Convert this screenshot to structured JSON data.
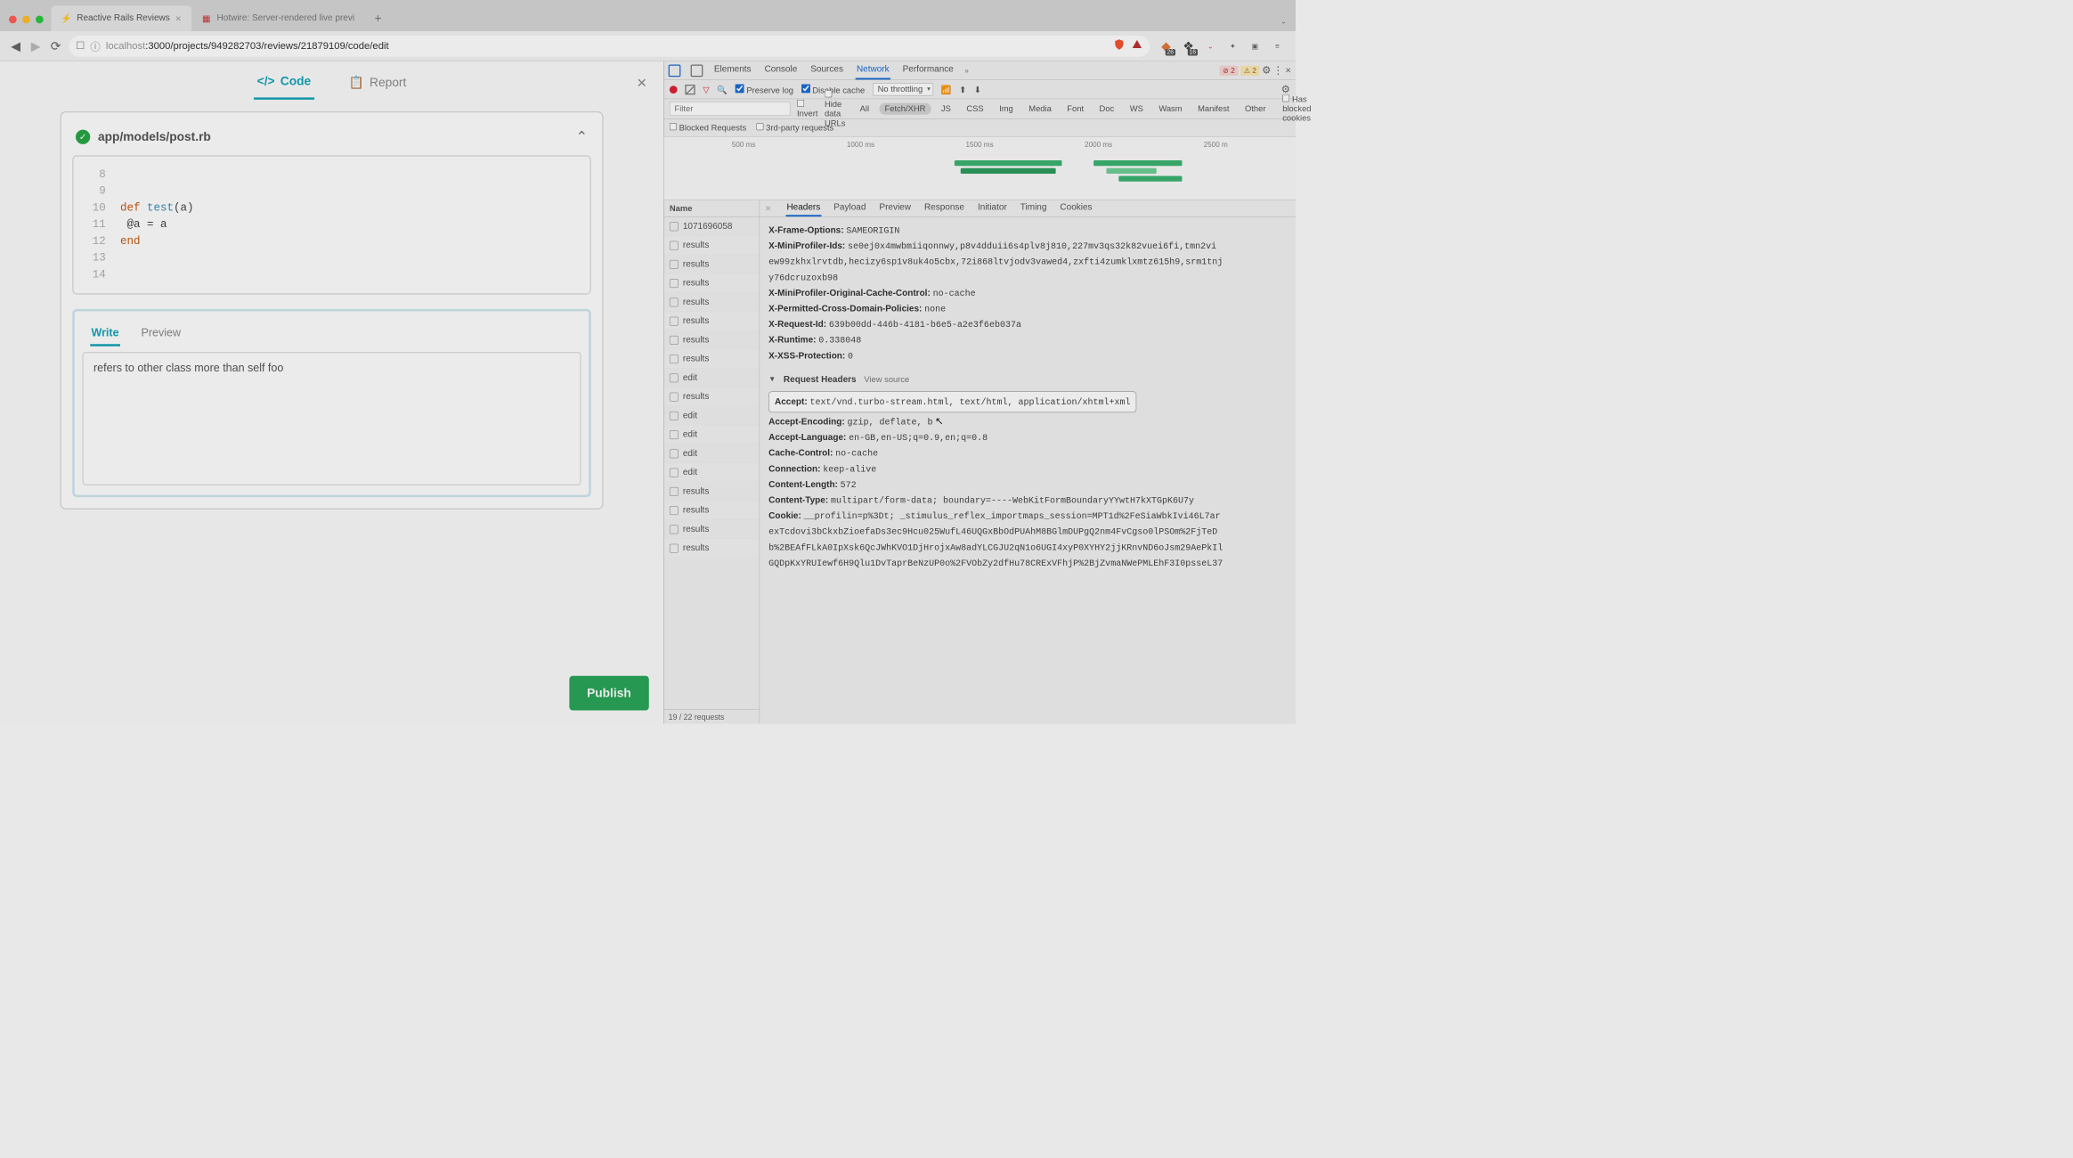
{
  "browser": {
    "tabs": [
      {
        "title": "Reactive Rails Reviews",
        "active": true,
        "favicon": "⚡"
      },
      {
        "title": "Hotwire: Server-rendered live previ",
        "active": false,
        "favicon": "📄"
      }
    ],
    "url_display_host": "localhost",
    "url_display_rest": ":3000/projects/949282703/reviews/21879109/code/edit",
    "ext_badge1": "26",
    "ext_badge2": "16"
  },
  "page": {
    "tabs": {
      "code": "Code",
      "report": "Report"
    },
    "file_path": "app/models/post.rb",
    "code_lines": [
      {
        "ln": "8",
        "text": ""
      },
      {
        "ln": "9",
        "text": ""
      },
      {
        "ln": "10",
        "kw": "def ",
        "fn": "test",
        "rest": "(a)"
      },
      {
        "ln": "11",
        "indent": "    ",
        "text": "@a = a"
      },
      {
        "ln": "12",
        "kw": "end"
      },
      {
        "ln": "13",
        "text": ""
      },
      {
        "ln": "14",
        "text": ""
      }
    ],
    "comment_tabs": {
      "write": "Write",
      "preview": "Preview"
    },
    "comment_text": "refers to other class more than self foo",
    "publish": "Publish"
  },
  "devtools": {
    "top_tabs": [
      "Elements",
      "Console",
      "Sources",
      "Network",
      "Performance"
    ],
    "top_active": "Network",
    "err_count": "2",
    "warn_count": "2",
    "toolbar": {
      "preserve_log": "Preserve log",
      "disable_cache": "Disable cache",
      "throttling": "No throttling"
    },
    "filter": {
      "placeholder": "Filter",
      "invert": "Invert",
      "hide_data": "Hide data URLs",
      "chips": [
        "All",
        "Fetch/XHR",
        "JS",
        "CSS",
        "Img",
        "Media",
        "Font",
        "Doc",
        "WS",
        "Wasm",
        "Manifest",
        "Other"
      ],
      "chip_active": "Fetch/XHR",
      "has_blocked": "Has blocked cookies",
      "blocked_requests": "Blocked Requests",
      "third_party": "3rd-party requests"
    },
    "waterfall_ticks": [
      "500 ms",
      "1000 ms",
      "1500 ms",
      "2000 ms",
      "2500 m"
    ],
    "name_header": "Name",
    "requests": [
      "1071696058",
      "results",
      "results",
      "results",
      "results",
      "results",
      "results",
      "results",
      "edit",
      "results",
      "edit",
      "edit",
      "edit",
      "edit",
      "results",
      "results",
      "results",
      "results"
    ],
    "status_text": "19 / 22 requests",
    "detail_tabs": [
      "Headers",
      "Payload",
      "Preview",
      "Response",
      "Initiator",
      "Timing",
      "Cookies"
    ],
    "detail_active": "Headers",
    "response_headers": [
      {
        "k": "X-Frame-Options:",
        "v": "SAMEORIGIN"
      },
      {
        "k": "X-MiniProfiler-Ids:",
        "v": "se0ej0x4mwbmiiqonnwy,p8v4dduii6s4plv8j810,227mv3qs32k82vuei6fi,tmn2vi"
      },
      {
        "k": "",
        "v": "ew99zkhxlrvtdb,hecizy6sp1v8uk4o5cbx,72i868ltvjodv3vawed4,zxfti4zumklxmtz615h9,srm1tnj"
      },
      {
        "k": "",
        "v": "y76dcruzoxb98"
      },
      {
        "k": "X-MiniProfiler-Original-Cache-Control:",
        "v": "no-cache"
      },
      {
        "k": "X-Permitted-Cross-Domain-Policies:",
        "v": "none"
      },
      {
        "k": "X-Request-Id:",
        "v": "639b00dd-446b-4181-b6e5-a2e3f6eb037a"
      },
      {
        "k": "X-Runtime:",
        "v": "0.338048"
      },
      {
        "k": "X-XSS-Protection:",
        "v": "0"
      }
    ],
    "request_section": {
      "title": "Request Headers",
      "view_source": "View source"
    },
    "request_headers": [
      {
        "k": "Accept:",
        "v": "text/vnd.turbo-stream.html, text/html, application/xhtml+xml",
        "highlight": true
      },
      {
        "k": "Accept-Encoding:",
        "v": "gzip, deflate, b"
      },
      {
        "k": "Accept-Language:",
        "v": "en-GB,en-US;q=0.9,en;q=0.8"
      },
      {
        "k": "Cache-Control:",
        "v": "no-cache"
      },
      {
        "k": "Connection:",
        "v": "keep-alive"
      },
      {
        "k": "Content-Length:",
        "v": "572"
      },
      {
        "k": "Content-Type:",
        "v": "multipart/form-data; boundary=----WebKitFormBoundaryYYwtH7kXTGpK6U7y"
      },
      {
        "k": "Cookie:",
        "v": "__profilin=p%3Dt; _stimulus_reflex_importmaps_session=MPT1d%2FeSiaWbkIvi46L7ar"
      },
      {
        "k": "",
        "v": "exTcdovi3bCkxbZioefaDs3ec9Hcu025WufL46UQGxBbOdPUAhM8BGlmDUPgQ2nm4FvCgso0lPSOm%2FjTeD"
      },
      {
        "k": "",
        "v": "b%2BEAfFLkA0IpXsk6QcJWhKVO1DjHrojxAw8adYLCGJU2qN1o6UGI4xyP0XYHY2jjKRnvND6oJsm29AePkIl"
      },
      {
        "k": "",
        "v": "GQDpKxYRUIewf6H9Qlu1DvTaprBeNzUP0o%2FVObZy2dfHu78CRExVFhjP%2BjZvmaNWePMLEhF3I0psseL37"
      }
    ]
  }
}
